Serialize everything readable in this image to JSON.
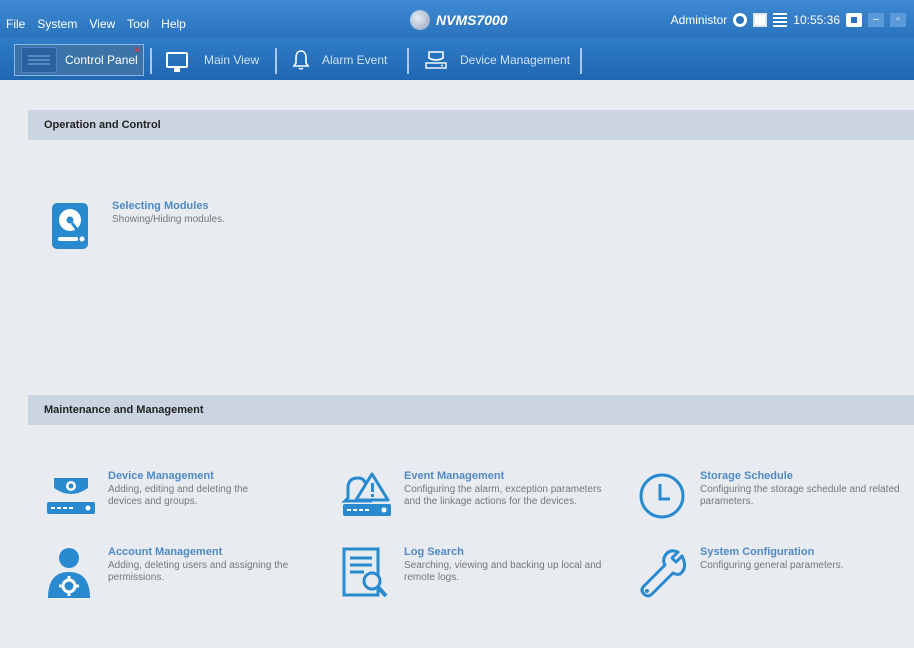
{
  "menu": [
    "File",
    "System",
    "View",
    "Tool",
    "Help"
  ],
  "app_title": "NVMS7000",
  "status": {
    "user": "Administor",
    "time": "10:55:36",
    "icons": [
      "globe-icon",
      "cpu-icon",
      "hdd-icon",
      "lock-icon"
    ],
    "window_buttons": [
      "minimize",
      "maximize"
    ]
  },
  "tabs": [
    {
      "label": "Control Panel",
      "icon": "control-panel-icon",
      "active": true
    },
    {
      "label": "Main View",
      "icon": "monitor-icon",
      "active": false
    },
    {
      "label": "Alarm Event",
      "icon": "bell-icon",
      "active": false
    },
    {
      "label": "Device Management",
      "icon": "device-icon",
      "active": false
    }
  ],
  "sections": {
    "operation": {
      "title": "Operation and Control",
      "modules": [
        {
          "title": "Selecting Modules",
          "desc": "Showing/Hiding modules.",
          "icon": "hdd-module-icon"
        }
      ]
    },
    "maintenance": {
      "title": "Maintenance and Management",
      "modules": [
        {
          "title": "Device Management",
          "desc": "Adding, editing and deleting the devices and groups.",
          "icon": "camera-device-icon"
        },
        {
          "title": "Event Management",
          "desc": "Configuring the alarm, exception parameters and the linkage actions for the devices.",
          "icon": "alarm-device-icon"
        },
        {
          "title": "Storage Schedule",
          "desc": "Configuring the storage schedule and related parameters.",
          "icon": "clock-icon"
        },
        {
          "title": "Account Management",
          "desc": "Adding, deleting users and assigning the permissions.",
          "icon": "user-gear-icon"
        },
        {
          "title": "Log Search",
          "desc": "Searching, viewing and backing up local and remote logs.",
          "icon": "log-search-icon"
        },
        {
          "title": "System Configuration",
          "desc": "Configuring general parameters.",
          "icon": "wrench-icon"
        }
      ]
    }
  },
  "colors": {
    "title_bar": "#2a73bd",
    "accent": "#2a8ad0",
    "module_title": "#4f8ac5",
    "section_header_bg": "#cad5e1"
  }
}
